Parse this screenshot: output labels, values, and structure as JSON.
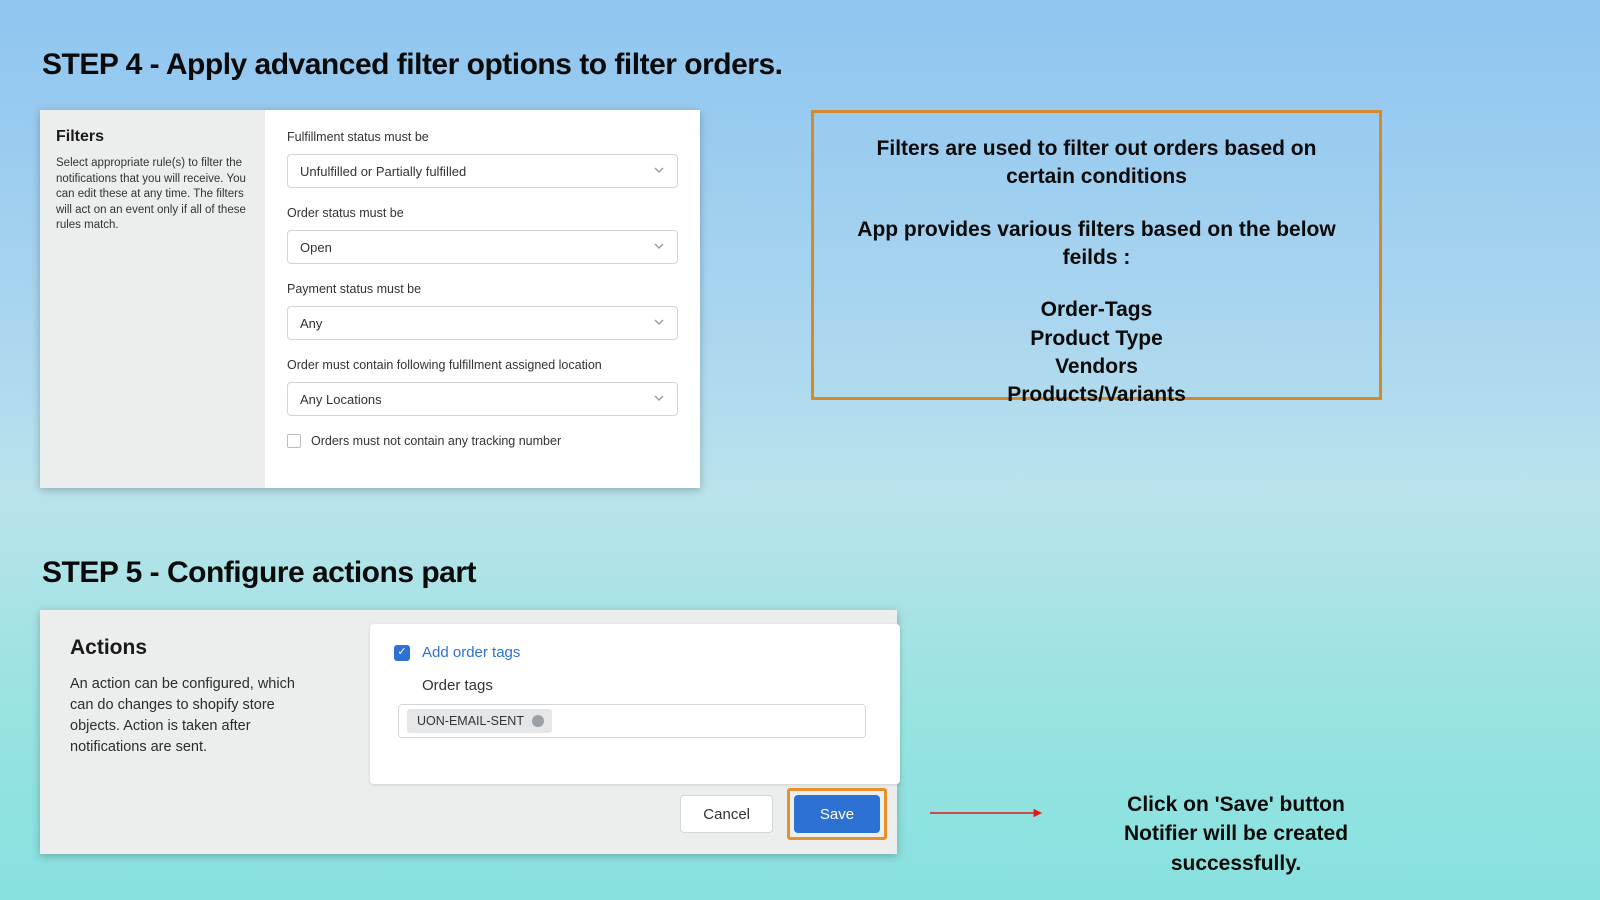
{
  "step4": {
    "heading": "STEP 4 - Apply advanced filter options to filter orders.",
    "panel": {
      "title": "Filters",
      "description": "Select appropriate rule(s) to filter the notifications that you will receive. You can edit these at any time. The filters will act on an event only if all of these rules match.",
      "fields": {
        "fulfillment": {
          "label": "Fulfillment status must be",
          "value": "Unfulfilled or Partially fulfilled"
        },
        "order": {
          "label": "Order status must be",
          "value": "Open"
        },
        "payment": {
          "label": "Payment status must be",
          "value": "Any"
        },
        "location": {
          "label": "Order must contain following fulfillment assigned location",
          "value": "Any Locations"
        },
        "tracking_checkbox": "Orders must not contain any tracking number"
      }
    },
    "callout": {
      "l1": "Filters are used to filter out orders based on",
      "l2": "certain conditions",
      "l3": "App provides various filters based on the below feilds :",
      "f1": "Order-Tags",
      "f2": "Product Type",
      "f3": "Vendors",
      "f4": "Products/Variants"
    }
  },
  "step5": {
    "heading": "STEP 5 - Configure actions part",
    "panel": {
      "title": "Actions",
      "description": "An action can be configured, which can do changes to shopify store objects. Action is taken after notifications are sent.",
      "add_label": "Add order tags",
      "tags_label": "Order tags",
      "tag_value": "UON-EMAIL-SENT",
      "cancel": "Cancel",
      "save": "Save"
    },
    "note": {
      "l1": "Click on 'Save' button",
      "l2": "Notifier will be created successfully."
    }
  }
}
